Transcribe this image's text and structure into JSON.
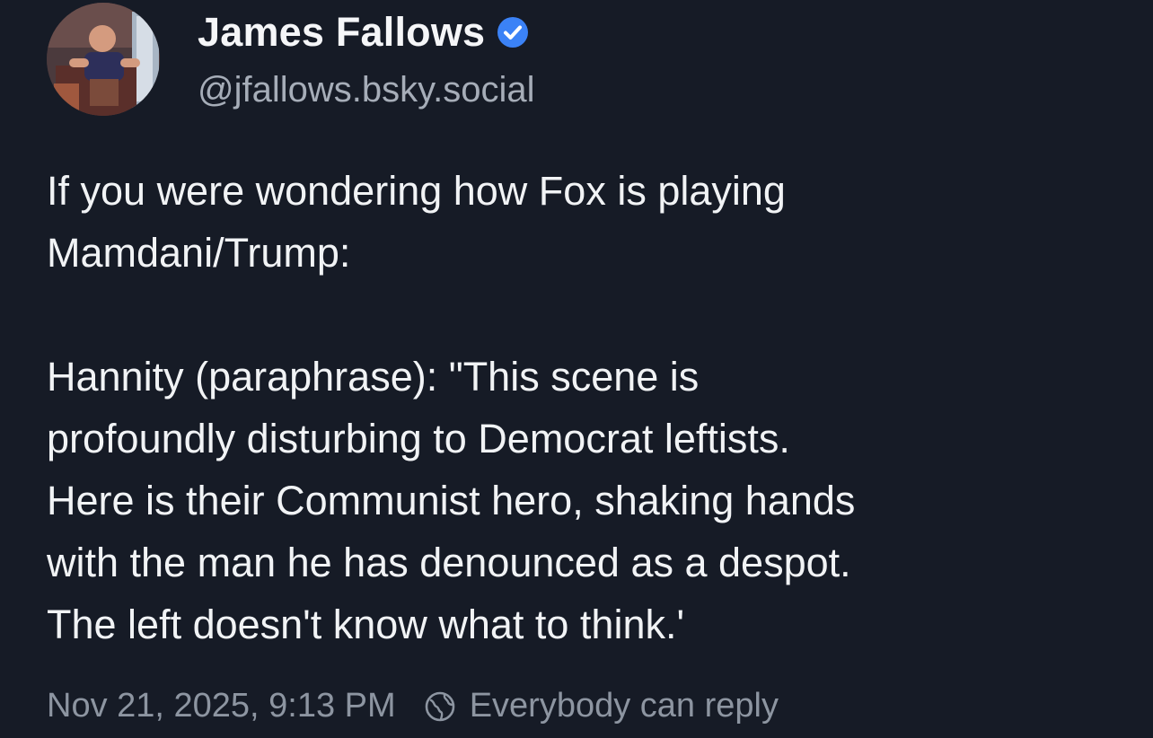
{
  "author": {
    "display_name": "James Fallows",
    "handle": "@jfallows.bsky.social",
    "verified": true,
    "verified_color": "#3b82f6",
    "avatar_icon": "user-avatar-photo"
  },
  "post": {
    "paragraphs": [
      "If you were wondering how Fox is playing\nMamdani/Trump:",
      "Hannity (paraphrase): \"This scene is\nprofoundly disturbing to Democrat leftists.\nHere is their Communist hero, shaking hands\nwith the man he has denounced as a despot.\nThe left doesn't know what to think.'"
    ],
    "timestamp": "Nov 21, 2025, 9:13 PM",
    "reply_setting": "Everybody can reply",
    "reply_icon": "earth-globe-icon"
  },
  "colors": {
    "background": "#161b26",
    "text": "#f1f3f5",
    "muted": "#8d95a1",
    "handle": "#a6adb8"
  }
}
